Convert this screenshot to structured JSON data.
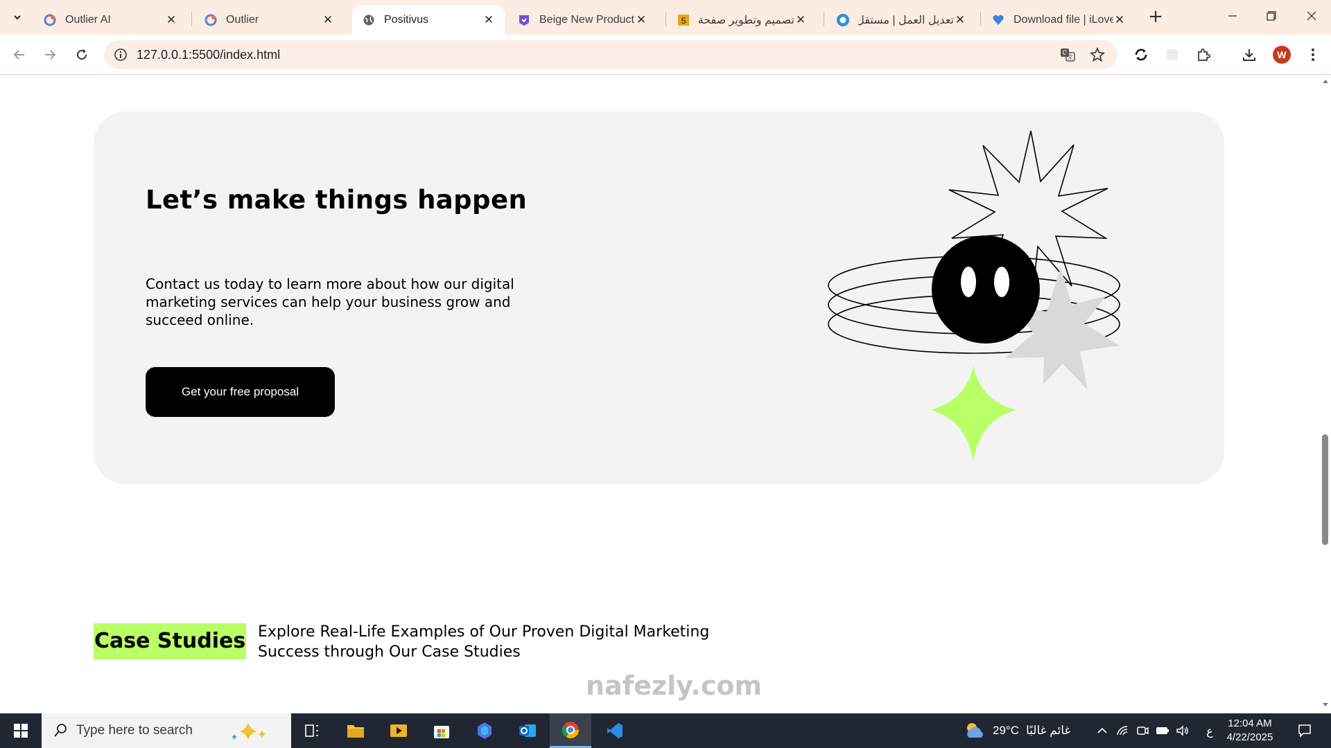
{
  "browser": {
    "tabs": [
      {
        "title": "Outlier AI",
        "favicon": "outlier-icon",
        "active": false
      },
      {
        "title": "Outlier",
        "favicon": "outlier-icon",
        "active": false
      },
      {
        "title": "Positivus",
        "favicon": "globe-icon",
        "active": true
      },
      {
        "title": "Beige New Product M",
        "favicon": "canva-icon",
        "active": false
      },
      {
        "title": "تصميم وتطوير صفحة",
        "favicon": "html5-icon",
        "active": false
      },
      {
        "title": "تعديل العمل | مستقل",
        "favicon": "mostaql-icon",
        "active": false
      },
      {
        "title": "Download file | iLove",
        "favicon": "ilovepdf-icon",
        "active": false
      }
    ],
    "address": "127.0.0.1:5500/index.html",
    "profile_initial": "W"
  },
  "page": {
    "cta": {
      "title": "Let’s make things happen",
      "text": "Contact us today to learn more about how our digital marketing services can help your business grow and succeed online.",
      "button": "Get your free proposal"
    },
    "case_studies": {
      "heading": "Case Studies",
      "text": "Explore Real-Life Examples of Our Proven Digital Marketing Success through Our Case Studies"
    },
    "watermark": "nafezly.com"
  },
  "taskbar": {
    "search_placeholder": "Type here to search",
    "weather": {
      "temp": "29°C",
      "condition": "غائم غالبًا"
    },
    "language": "ع",
    "time": "12:04 AM",
    "date": "4/22/2025"
  },
  "colors": {
    "accent_green": "#b9ff66",
    "card_bg": "#f3f3f3",
    "tabstrip_bg": "#fcece2",
    "taskbar_bg": "#202632"
  }
}
